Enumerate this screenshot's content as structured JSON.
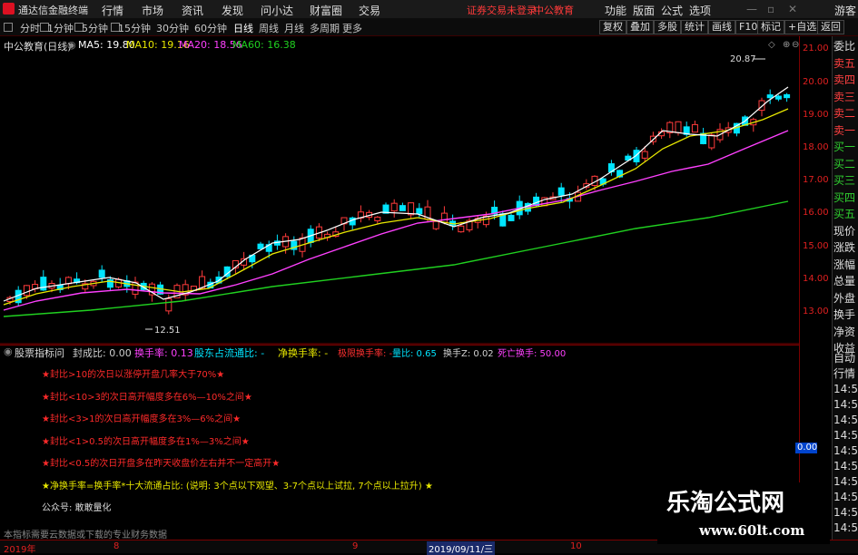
{
  "titlebar": {
    "app_title": "通达信金融终端",
    "menus": [
      "行情",
      "市场",
      "资讯",
      "发现",
      "问小达",
      "财富圈",
      "交易"
    ],
    "notice": "证券交易未登录",
    "notice2": "中公教育",
    "right_menus": [
      "功能",
      "版面",
      "公式",
      "选项"
    ],
    "guest": "游客"
  },
  "periods": [
    "分时",
    "1分钟",
    "5分钟",
    "15分钟",
    "30分钟",
    "60分钟",
    "日线",
    "周线",
    "月线",
    "多周期",
    "更多"
  ],
  "active_period": "日线",
  "right_buttons": [
    "复权",
    "叠加",
    "多股",
    "统计",
    "画线",
    "F10",
    "标记",
    "+自选",
    "返回"
  ],
  "chart_header": {
    "stock_name": "中公教育(日线)",
    "ma5": "MA5: 19.80",
    "ma10": "MA10: 19.16",
    "ma20": "MA20: 18.56",
    "ma60": "MA60: 16.38"
  },
  "colors": {
    "up": "#ff3b3b",
    "down": "#00e5ff",
    "ma5": "#ffffff",
    "ma10": "#e8e800",
    "ma20": "#ff40ff",
    "ma60": "#20d020"
  },
  "price_axis": [
    "21.00",
    "20.00",
    "19.00",
    "18.00",
    "17.00",
    "16.00",
    "15.00",
    "14.00",
    "13.00"
  ],
  "annotations": {
    "high": "20.87",
    "low": "12.51"
  },
  "side_panel": [
    "委比",
    "卖五",
    "卖四",
    "卖三",
    "卖二",
    "卖一",
    "买一",
    "买二",
    "买三",
    "买四",
    "买五",
    "现价",
    "涨跌",
    "涨幅",
    "总量",
    "外盘",
    "换手",
    "净资",
    "收益"
  ],
  "side_panel2": [
    "自动",
    "行情",
    "14:5",
    "14:5",
    "14:5",
    "14:5",
    "14:5",
    "14:5",
    "14:5",
    "14:5",
    "14:5",
    "14:5"
  ],
  "panel_value": "0.00",
  "indicator": {
    "name": "股票指标问",
    "items": [
      {
        "label": "封成比: 0.00",
        "color": "#d0d0d0"
      },
      {
        "label": "换手率: 0.13",
        "color": "#ff40ff"
      },
      {
        "label": "股东占流通比: -",
        "color": "#00e5ff"
      },
      {
        "label": "净换手率: -",
        "color": "#e8e800"
      },
      {
        "label": "极限换手率: -",
        "color": "#ff3030"
      },
      {
        "label": "量比: 0.65",
        "color": "#00e5ff"
      },
      {
        "label": "换手Z: 0.02",
        "color": "#d0d0d0"
      },
      {
        "label": "死亡换手: 50.00",
        "color": "#ff40ff"
      }
    ],
    "value": "0.00"
  },
  "rules": [
    "★封比>10的次日以涨停开盘几率大于70%★",
    "★封比<10>3的次日高开幅度多在6%—10%之间★",
    "★封比<3>1的次日高开幅度多在3%—6%之间★",
    "★封比<1>0.5的次日高开幅度多在1%—3%之间★",
    "★封比<0.5的次日开盘多在昨天收盘价左右并不一定高开★"
  ],
  "formula_note": "★净换手率=换手率*十大流通占比: (说明: 3个点以下观望、3-7个点以上试拉, 7个点以上拉升) ★",
  "public_account": "公众号: 敢敢量化",
  "bottom_note": "本指标需要云数据或下载的专业财务数据",
  "dates": [
    "2019年",
    "8",
    "9",
    "2019/09/11/三",
    "10"
  ],
  "watermark": {
    "line1": "乐淘公式网",
    "line2": "www.60lt.com"
  }
}
